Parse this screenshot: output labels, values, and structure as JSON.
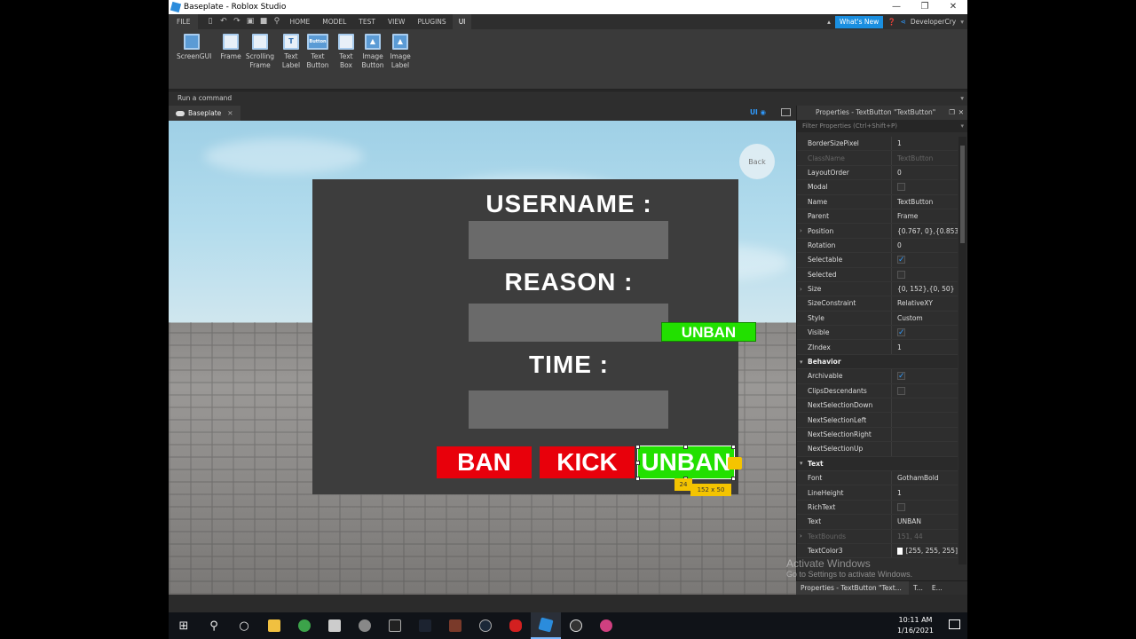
{
  "window": {
    "title": "Baseplate - Roblox Studio",
    "controls": [
      "—",
      "❐",
      "✕"
    ]
  },
  "menu": {
    "file": "FILE",
    "tabs": [
      "HOME",
      "MODEL",
      "TEST",
      "VIEW",
      "PLUGINS",
      "UI"
    ],
    "active_tab": "UI",
    "whats_new": "What's New",
    "user": "DeveloperCry"
  },
  "ribbon": {
    "items": [
      {
        "l1": "ScreenGUI",
        "l2": ""
      },
      {
        "l1": "Frame",
        "l2": ""
      },
      {
        "l1": "Scrolling",
        "l2": "Frame"
      },
      {
        "l1": "Text",
        "l2": "Label",
        "glyph": "T"
      },
      {
        "l1": "Text",
        "l2": "Button",
        "glyph": "Button"
      },
      {
        "l1": "Text",
        "l2": "Box"
      },
      {
        "l1": "Image",
        "l2": "Button"
      },
      {
        "l1": "Image",
        "l2": "Label"
      }
    ]
  },
  "command_bar": {
    "placeholder": "Run a command"
  },
  "doc_tab": {
    "label": "Baseplate",
    "close": "✕",
    "ui_toggle": "UI"
  },
  "viewport": {
    "back": "Back",
    "username_label": "USERNAME :",
    "reason_label": "REASON :",
    "time_label": "TIME :",
    "ban": "BAN",
    "kick": "KICK",
    "unban": "UNBAN",
    "unban_preview": "UNBAN",
    "size_tip": "152 x 50",
    "pos_tip": "24"
  },
  "properties": {
    "title": "Properties - TextButton \"TextButton\"",
    "filter_placeholder": "Filter Properties (Ctrl+Shift+P)",
    "rows": [
      {
        "name": "BorderSizePixel",
        "value": "1"
      },
      {
        "name": "ClassName",
        "value": "TextButton",
        "dim": true
      },
      {
        "name": "LayoutOrder",
        "value": "0"
      },
      {
        "name": "Modal",
        "value": "",
        "check": "off"
      },
      {
        "name": "Name",
        "value": "TextButton"
      },
      {
        "name": "Parent",
        "value": "Frame"
      },
      {
        "name": "Position",
        "value": "{0.767, 0},{0.853...",
        "arrow": true
      },
      {
        "name": "Rotation",
        "value": "0"
      },
      {
        "name": "Selectable",
        "value": "",
        "check": "on"
      },
      {
        "name": "Selected",
        "value": "",
        "check": "off"
      },
      {
        "name": "Size",
        "value": "{0, 152},{0, 50}",
        "arrow": true
      },
      {
        "name": "SizeConstraint",
        "value": "RelativeXY"
      },
      {
        "name": "Style",
        "value": "Custom"
      },
      {
        "name": "Visible",
        "value": "",
        "check": "on"
      },
      {
        "name": "ZIndex",
        "value": "1"
      },
      {
        "name": "Behavior",
        "value": "",
        "cat": true
      },
      {
        "name": "Archivable",
        "value": "",
        "check": "on"
      },
      {
        "name": "ClipsDescendants",
        "value": "",
        "check": "off"
      },
      {
        "name": "NextSelectionDown",
        "value": ""
      },
      {
        "name": "NextSelectionLeft",
        "value": ""
      },
      {
        "name": "NextSelectionRight",
        "value": ""
      },
      {
        "name": "NextSelectionUp",
        "value": ""
      },
      {
        "name": "Text",
        "value": "",
        "cat": true
      },
      {
        "name": "Font",
        "value": "GothamBold"
      },
      {
        "name": "LineHeight",
        "value": "1"
      },
      {
        "name": "RichText",
        "value": "",
        "check": "off"
      },
      {
        "name": "Text",
        "value": "UNBAN"
      },
      {
        "name": "TextBounds",
        "value": "151, 44",
        "dim": true,
        "arrow": true
      },
      {
        "name": "TextColor3",
        "value": "[255, 255, 255]",
        "swatch": "#ffffff"
      }
    ],
    "bottom_tabs": [
      "Properties - TextButton \"Text...",
      "T...",
      "E..."
    ]
  },
  "watermark": {
    "line1": "Activate Windows",
    "line2": "Go to Settings to activate Windows."
  },
  "taskbar": {
    "time": "10:11 AM",
    "date": "1/16/2021"
  }
}
